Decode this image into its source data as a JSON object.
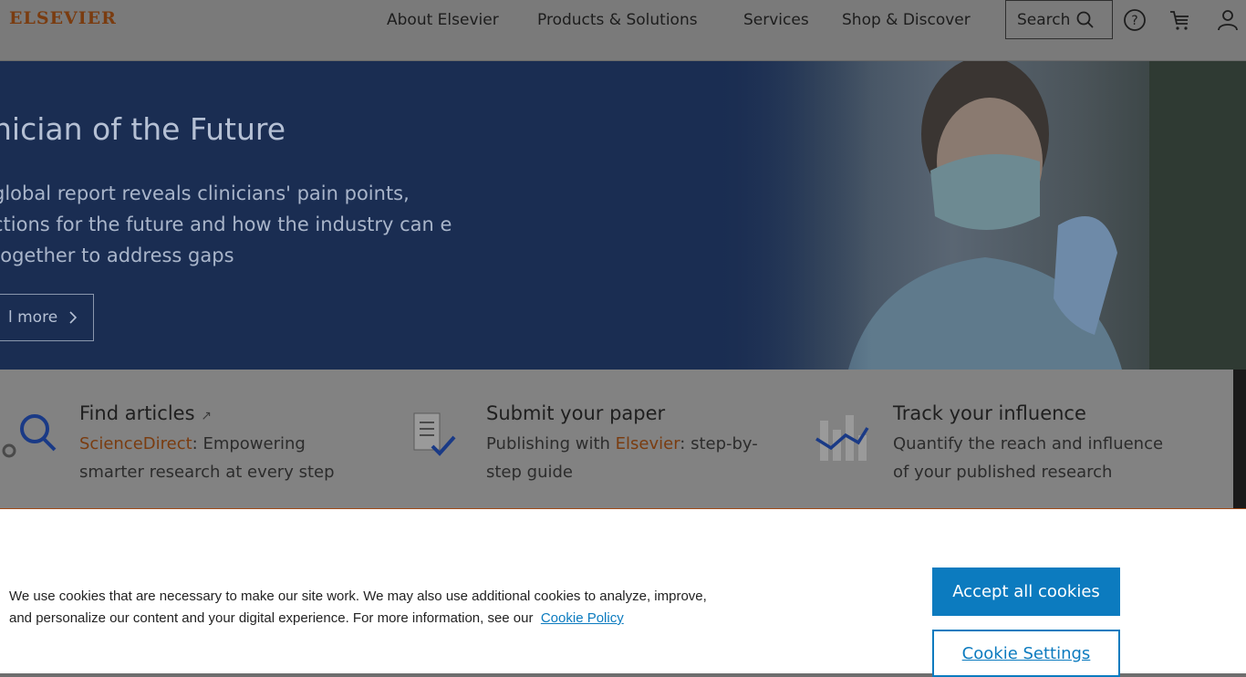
{
  "header": {
    "logo": "ELSEVIER",
    "nav": [
      "About Elsevier",
      "Products & Solutions",
      "Services",
      "Shop & Discover"
    ],
    "search_label": "Search"
  },
  "hero": {
    "title": "nician of the Future",
    "description": "global report reveals clinicians' pain points, ctions for the future and how the industry can e together to address gaps",
    "button_label": "l more"
  },
  "quick_links": [
    {
      "title": "Find articles",
      "desc_accent": "ScienceDirect",
      "desc": ": Empowering smarter research at every step"
    },
    {
      "title": "Submit your paper",
      "desc_prefix": "Publishing with ",
      "desc_accent": "Elsevier",
      "desc": ": step-by-step guide"
    },
    {
      "title": "Track your influence",
      "desc": "Quantify the reach and influence of your published research"
    }
  ],
  "cookie": {
    "text": "We use cookies that are necessary to make our site work. We may also use additional cookies to analyze, improve, and personalize our content and your digital experience. For more information, see our",
    "link": "Cookie Policy",
    "accept_label": "Accept all cookies",
    "settings_label": "Cookie Settings"
  },
  "colors": {
    "brand": "#eb6500",
    "primary_button": "#007398",
    "hero_bg": "#1f4287"
  }
}
